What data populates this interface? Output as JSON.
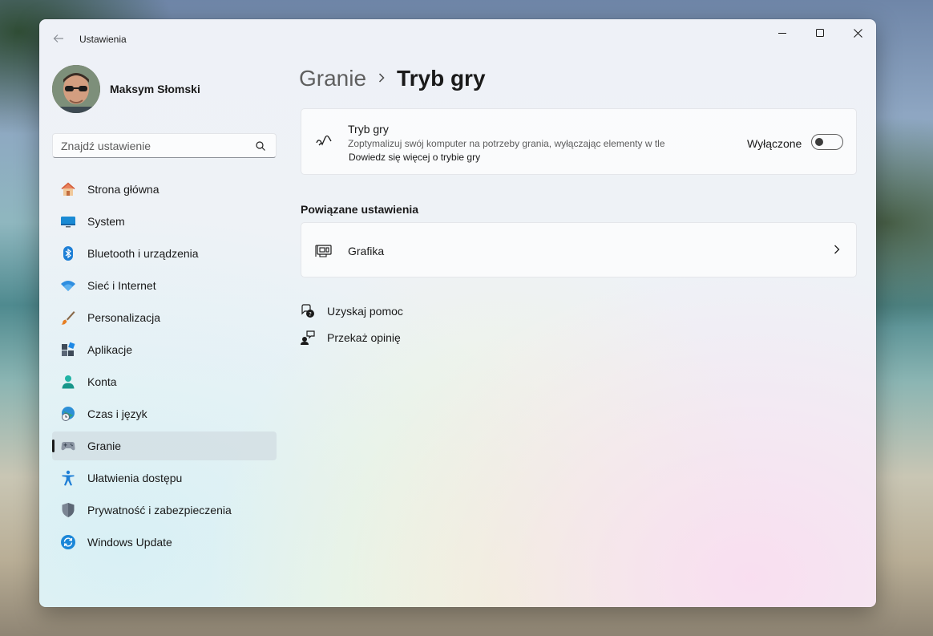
{
  "window": {
    "app_title": "Ustawienia"
  },
  "profile": {
    "name": "Maksym Słomski"
  },
  "search": {
    "placeholder": "Znajdź ustawienie"
  },
  "sidebar": {
    "items": [
      {
        "label": "Strona główna",
        "icon": "home-icon"
      },
      {
        "label": "System",
        "icon": "monitor-icon"
      },
      {
        "label": "Bluetooth i urządzenia",
        "icon": "bluetooth-icon"
      },
      {
        "label": "Sieć i Internet",
        "icon": "wifi-icon"
      },
      {
        "label": "Personalizacja",
        "icon": "brush-icon"
      },
      {
        "label": "Aplikacje",
        "icon": "apps-icon"
      },
      {
        "label": "Konta",
        "icon": "person-icon"
      },
      {
        "label": "Czas i język",
        "icon": "globe-clock-icon"
      },
      {
        "label": "Granie",
        "icon": "gamepad-icon",
        "active": true
      },
      {
        "label": "Ułatwienia dostępu",
        "icon": "accessibility-icon"
      },
      {
        "label": "Prywatność i zabezpieczenia",
        "icon": "shield-icon"
      },
      {
        "label": "Windows Update",
        "icon": "update-icon"
      }
    ]
  },
  "breadcrumb": {
    "parent": "Granie",
    "separator": "›",
    "current": "Tryb gry"
  },
  "game_mode": {
    "title": "Tryb gry",
    "description": "Zoptymalizuj swój komputer na potrzeby grania, wyłączając elementy w tle",
    "link": "Dowiedz się więcej o trybie gry",
    "toggle_label": "Wyłączone",
    "toggle_on": false
  },
  "related": {
    "title": "Powiązane ustawienia",
    "grafika_label": "Grafika"
  },
  "links": {
    "help": "Uzyskaj pomoc",
    "feedback": "Przekaż opinię"
  },
  "colors": {
    "accent_blue": "#0067c0",
    "text": "#1a1a1a",
    "secondary_text": "#5c5c5c"
  }
}
